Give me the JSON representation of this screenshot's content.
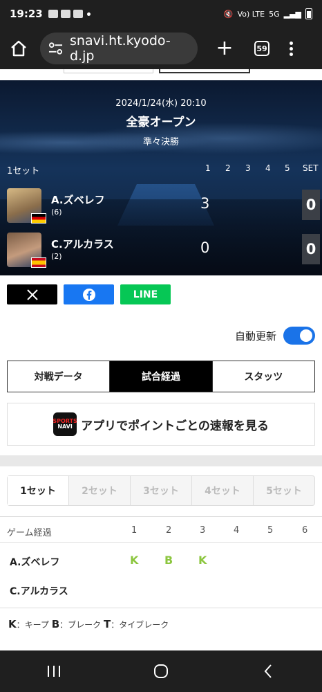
{
  "status": {
    "time": "19:23",
    "signal": "5G",
    "lte": "Vo) LTE"
  },
  "browser": {
    "url": "snavi.ht.kyodo-d.jp",
    "tab_count": "59"
  },
  "match": {
    "datetime": "2024/1/24(水) 20:10",
    "tournament": "全豪オープン",
    "round": "準々決勝",
    "set_label": "1セット",
    "columns": [
      "1",
      "2",
      "3",
      "4",
      "5",
      "SET"
    ],
    "players": [
      {
        "name": "A.ズベレフ",
        "seed": "(6)",
        "set1": "3",
        "sets": "0",
        "flag": "Germany"
      },
      {
        "name": "C.アルカラス",
        "seed": "(2)",
        "set1": "0",
        "sets": "0",
        "flag": "Spain"
      }
    ]
  },
  "share": {
    "x": "X",
    "facebook": "f",
    "line": "LINE"
  },
  "auto_update": {
    "label": "自動更新",
    "enabled": true
  },
  "tabs": [
    "対戦データ",
    "試合経過",
    "スタッツ"
  ],
  "app_banner": {
    "text": "アプリでポイントごとの速報を見る",
    "logo_top": "SPORTS",
    "logo_bottom": "NAVI"
  },
  "set_tabs": [
    "1セット",
    "2セット",
    "3セット",
    "4セット",
    "5セット"
  ],
  "game_table": {
    "header_label": "ゲーム経過",
    "games": [
      "1",
      "2",
      "3",
      "4",
      "5",
      "6"
    ],
    "rows": [
      {
        "player": "A.ズベレフ",
        "results": [
          "K",
          "B",
          "K",
          "",
          "",
          ""
        ]
      },
      {
        "player": "C.アルカラス",
        "results": [
          "",
          "",
          "",
          "",
          "",
          ""
        ]
      }
    ]
  },
  "legend": {
    "k": "K",
    "k_text": "：キープ",
    "b": "B",
    "b_text": "：ブレーク",
    "t": "T",
    "t_text": "：タイブレーク"
  },
  "colors": {
    "accent": "#1a73e8",
    "game_mark": "#8cc63f",
    "facebook": "#1877f2",
    "line": "#06c755"
  }
}
